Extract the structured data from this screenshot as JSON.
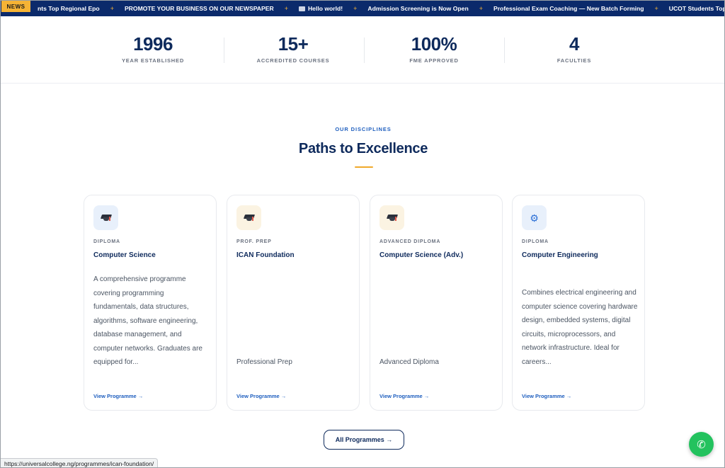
{
  "ticker": {
    "badge": "NEWS",
    "items": [
      {
        "text": "nts Top Regional Epo"
      },
      {
        "text": "PROMOTE YOUR BUSINESS ON OUR NEWSPAPER"
      },
      {
        "text": "Hello world!"
      },
      {
        "text": "Admission Screening is Now Open"
      },
      {
        "text": "Professional Exam Coaching — New Batch Forming"
      },
      {
        "text": "UCOT Students Top Regional Epo"
      }
    ],
    "separator": "+"
  },
  "stats": [
    {
      "value": "1996",
      "label": "YEAR ESTABLISHED"
    },
    {
      "value": "15+",
      "label": "ACCREDITED COURSES"
    },
    {
      "value": "100%",
      "label": "FME APPROVED"
    },
    {
      "value": "4",
      "label": "FACULTIES"
    }
  ],
  "section": {
    "eyebrow": "OUR DISCIPLINES",
    "title": "Paths to Excellence"
  },
  "cards": [
    {
      "icon": "graduation-cap-icon",
      "type": "DIPLOMA",
      "name": "Computer Science",
      "desc": "A comprehensive programme covering programming fundamentals, data structures, algorithms, software engineering, database management, and computer networks. Graduates are equipped for...",
      "link": "View Programme →"
    },
    {
      "icon": "graduation-cap-icon",
      "type": "PROF. PREP",
      "name": "ICAN Foundation",
      "desc": "Professional Prep",
      "link": "View Programme →"
    },
    {
      "icon": "graduation-cap-icon",
      "type": "ADVANCED DIPLOMA",
      "name": "Computer Science (Adv.)",
      "desc": "Advanced Diploma",
      "link": "View Programme →"
    },
    {
      "icon": "gear-icon",
      "type": "DIPLOMA",
      "name": "Computer Engineering",
      "desc": "Combines electrical engineering and computer science covering hardware design, embedded systems, digital circuits, microprocessors, and network infrastructure. Ideal for careers...",
      "link": "View Programme →"
    }
  ],
  "all_programmes_label": "All Programmes →",
  "fab_icon": "phone-icon",
  "status_url": "https://universalcollege.ng/programmes/ican-foundation/",
  "colors": {
    "navy": "#0e2a5c",
    "ticker_bg": "#0b2a6b",
    "accent": "#f0a92b",
    "link": "#1f5fbf",
    "fab": "#23c25e"
  }
}
